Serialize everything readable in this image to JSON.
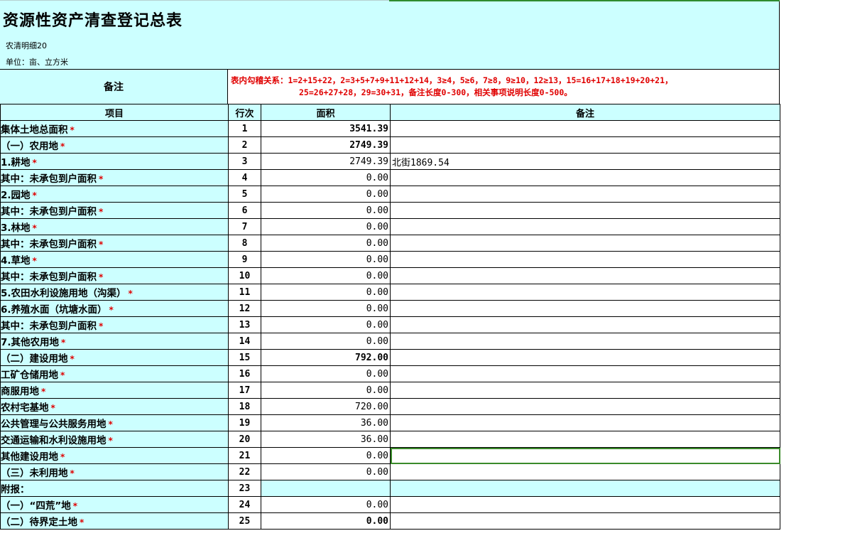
{
  "header": {
    "title": "资源性资产清查登记总表",
    "subtitle": "农清明细20",
    "unit": "单位：亩、立方米"
  },
  "note_row": {
    "label": "备注",
    "rule_line1": "表内勾稽关系：1=2+15+22，2=3+5+7+9+11+12+14，3≥4，5≥6，7≥8，9≥10，12≥13，15=16+17+18+19+20+21，",
    "rule_line2": "25=26+27+28，29=30+31，备注长度0-300，相关事项说明长度0-500。"
  },
  "columns": {
    "item": "项目",
    "line_no": "行次",
    "area": "面积",
    "note": "备注"
  },
  "required_mark": "*",
  "rows": [
    {
      "label": "集体土地总面积",
      "no": "1",
      "area": "3541.39",
      "note": ""
    },
    {
      "label": "（一）农用地",
      "no": "2",
      "area": "2749.39",
      "note": ""
    },
    {
      "label": "1.耕地",
      "no": "3",
      "area": "2749.39",
      "note": "北街1869.54"
    },
    {
      "label": "其中：未承包到户面积",
      "no": "4",
      "area": "0.00",
      "note": ""
    },
    {
      "label": "2.园地",
      "no": "5",
      "area": "0.00",
      "note": ""
    },
    {
      "label": "其中：未承包到户面积",
      "no": "6",
      "area": "0.00",
      "note": ""
    },
    {
      "label": "3.林地",
      "no": "7",
      "area": "0.00",
      "note": ""
    },
    {
      "label": "其中：未承包到户面积",
      "no": "8",
      "area": "0.00",
      "note": ""
    },
    {
      "label": "4.草地",
      "no": "9",
      "area": "0.00",
      "note": ""
    },
    {
      "label": "其中：未承包到户面积",
      "no": "10",
      "area": "0.00",
      "note": ""
    },
    {
      "label": "5.农田水利设施用地（沟渠）",
      "no": "11",
      "area": "0.00",
      "note": ""
    },
    {
      "label": "6.养殖水面（坑塘水面）",
      "no": "12",
      "area": "0.00",
      "note": ""
    },
    {
      "label": "其中：未承包到户面积",
      "no": "13",
      "area": "0.00",
      "note": ""
    },
    {
      "label": "7.其他农用地",
      "no": "14",
      "area": "0.00",
      "note": ""
    },
    {
      "label": "（二）建设用地",
      "no": "15",
      "area": "792.00",
      "note": ""
    },
    {
      "label": "工矿仓储用地",
      "no": "16",
      "area": "0.00",
      "note": ""
    },
    {
      "label": "商服用地",
      "no": "17",
      "area": "0.00",
      "note": ""
    },
    {
      "label": "农村宅基地",
      "no": "18",
      "area": "720.00",
      "note": ""
    },
    {
      "label": "公共管理与公共服务用地",
      "no": "19",
      "area": "36.00",
      "note": ""
    },
    {
      "label": "交通运输和水利设施用地",
      "no": "20",
      "area": "36.00",
      "note": ""
    },
    {
      "label": "其他建设用地",
      "no": "21",
      "area": "0.00",
      "note": ""
    },
    {
      "label": "（三）未利用地",
      "no": "22",
      "area": "0.00",
      "note": ""
    },
    {
      "label": "附报：",
      "no": "23",
      "area": "",
      "note": ""
    },
    {
      "label": "（一）“四荒”地",
      "no": "24",
      "area": "0.00",
      "note": ""
    },
    {
      "label": "（二）待界定土地",
      "no": "25",
      "area": "0.00",
      "note": ""
    }
  ]
}
